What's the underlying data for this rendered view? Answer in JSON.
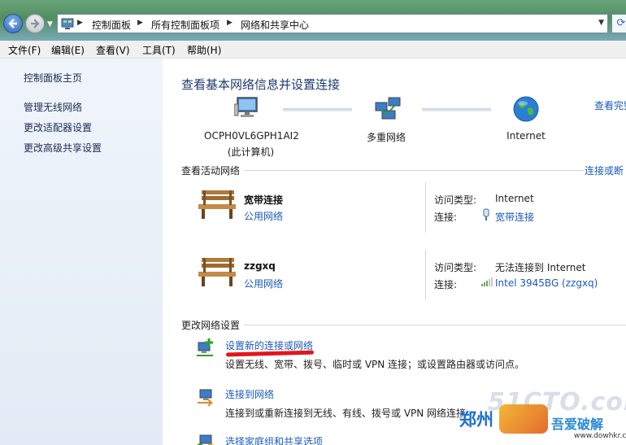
{
  "address_bar": {
    "crumbs": [
      "控制面板",
      "所有控制面板项",
      "网络和共享中心"
    ]
  },
  "menu": [
    "文件(F)",
    "编辑(E)",
    "查看(V)",
    "工具(T)",
    "帮助(H)"
  ],
  "sidebar": {
    "items": [
      {
        "label": "控制面板主页"
      },
      {
        "label": "管理无线网络"
      },
      {
        "label": "更改适配器设置"
      },
      {
        "label": "更改高级共享设置"
      }
    ]
  },
  "main": {
    "title": "查看基本网络信息并设置连接",
    "see_full_map": "查看完整",
    "map": {
      "computer_name": "OCPH0VL6GPH1AI2",
      "computer_sub": "(此计算机)",
      "network": "多重网络",
      "internet": "Internet"
    },
    "active": {
      "heading": "查看活动网络",
      "connect_link": "连接或断",
      "access_type_label": "访问类型:",
      "connection_label": "连接:",
      "networks": [
        {
          "name": "宽带连接",
          "category": "公用网络",
          "access_type": "Internet",
          "connection": "宽带连接"
        },
        {
          "name": "zzgxq",
          "category": "公用网络",
          "access_type": "无法连接到 Internet",
          "connection": "Intel 3945BG (zzgxq)"
        }
      ]
    },
    "change": {
      "heading": "更改网络设置",
      "tasks": [
        {
          "link": "设置新的连接或网络",
          "desc": "设置无线、宽带、拨号、临时或 VPN 连接；或设置路由器或访问点。"
        },
        {
          "link": "连接到网络",
          "desc": "连接到或重新连接到无线、有线、拨号或 VPN 网络连接"
        },
        {
          "link": "选择家庭组和共享选项",
          "desc": ""
        }
      ]
    }
  },
  "watermark": {
    "site": "51CTO.com",
    "brand": "郑州",
    "brand2": "吾爱破解",
    "url": "www.dowhkr.com"
  },
  "colors": {
    "link": "#1a5bb8",
    "annotation": "#e2161d",
    "sidebar_bg": "#e6eef7"
  }
}
